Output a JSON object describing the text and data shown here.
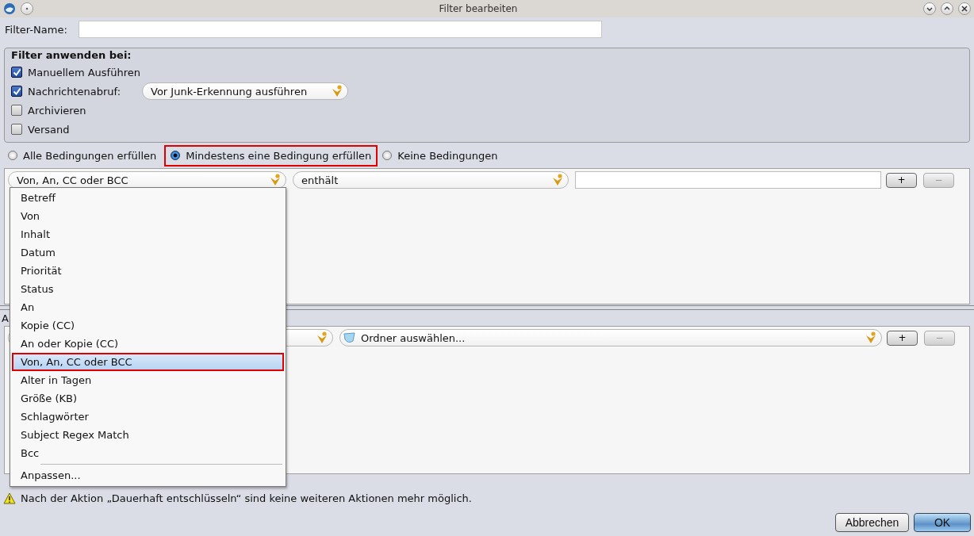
{
  "window": {
    "title": "Filter bearbeiten"
  },
  "filter_name": {
    "label": "Filter-Name:"
  },
  "apply_group": {
    "title": "Filter anwenden bei:",
    "options": [
      {
        "label": "Manuellem Ausführen",
        "checked": true
      },
      {
        "label": "Nachrichtenabruf:",
        "checked": true,
        "dropdown": "Vor Junk-Erkennung ausführen"
      },
      {
        "label": "Archivieren",
        "checked": false
      },
      {
        "label": "Versand",
        "checked": false
      }
    ]
  },
  "match_mode": [
    {
      "label": "Alle Bedingungen erfüllen",
      "selected": false,
      "annotated": false
    },
    {
      "label": "Mindestens eine Bedingung erfüllen",
      "selected": true,
      "annotated": true
    },
    {
      "label": "Keine Bedingungen",
      "selected": false,
      "annotated": false
    }
  ],
  "condition": {
    "field": "Von, An, CC oder BCC",
    "operator": "enthält",
    "add": "+",
    "remove": "−"
  },
  "actions_label": "A",
  "action": {
    "target": "Ordner auswählen...",
    "add": "+",
    "remove": "−"
  },
  "field_menu": [
    {
      "kind": "item",
      "label": "Betreff",
      "selected": false,
      "annotated": false
    },
    {
      "kind": "item",
      "label": "Von",
      "selected": false,
      "annotated": false
    },
    {
      "kind": "item",
      "label": "Inhalt",
      "selected": false,
      "annotated": false
    },
    {
      "kind": "item",
      "label": "Datum",
      "selected": false,
      "annotated": false
    },
    {
      "kind": "item",
      "label": "Priorität",
      "selected": false,
      "annotated": false
    },
    {
      "kind": "item",
      "label": "Status",
      "selected": false,
      "annotated": false
    },
    {
      "kind": "item",
      "label": "An",
      "selected": false,
      "annotated": false
    },
    {
      "kind": "item",
      "label": "Kopie (CC)",
      "selected": false,
      "annotated": false
    },
    {
      "kind": "item",
      "label": "An oder Kopie (CC)",
      "selected": false,
      "annotated": false
    },
    {
      "kind": "item",
      "label": "Von, An, CC oder BCC",
      "selected": true,
      "annotated": true
    },
    {
      "kind": "item",
      "label": "Alter in Tagen",
      "selected": false,
      "annotated": false
    },
    {
      "kind": "item",
      "label": "Größe (KB)",
      "selected": false,
      "annotated": false
    },
    {
      "kind": "item",
      "label": "Schlagwörter",
      "selected": false,
      "annotated": false
    },
    {
      "kind": "item",
      "label": "Subject Regex Match",
      "selected": false,
      "annotated": false
    },
    {
      "kind": "item",
      "label": "Bcc",
      "selected": false,
      "annotated": false
    },
    {
      "kind": "separator"
    },
    {
      "kind": "item",
      "label": "Anpassen...",
      "selected": false,
      "annotated": false
    }
  ],
  "warning": "Nach der Aktion „Dauerhaft entschlüsseln“ sind keine weiteren Aktionen mehr möglich.",
  "buttons": [
    {
      "label": "Abbrechen",
      "default": false
    },
    {
      "label": "OK",
      "default": true
    }
  ]
}
